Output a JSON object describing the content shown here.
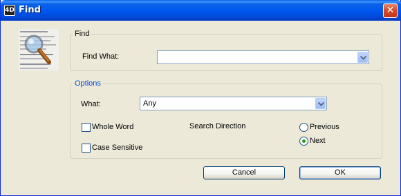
{
  "window": {
    "title": "Find",
    "app_icon_text": "4D",
    "close_glyph": "✕"
  },
  "find_group": {
    "legend": "Find",
    "find_what_label": "Find What:",
    "find_what_value": ""
  },
  "options_group": {
    "legend": "Options",
    "what_label": "What:",
    "what_value": "Any",
    "whole_word_label": "Whole Word",
    "whole_word_checked": false,
    "case_sensitive_label": "Case Sensitive",
    "case_sensitive_checked": false,
    "direction_label": "Search Direction",
    "direction_options": [
      "Previous",
      "Next"
    ],
    "direction_selected": "Next"
  },
  "buttons": {
    "cancel": "Cancel",
    "ok": "OK"
  },
  "colors": {
    "titlebar": "#0058ee",
    "legend_blue": "#0046d5",
    "radio_dot": "#21a121",
    "dialog_bg": "#ece9d8"
  },
  "icons": {
    "illustration": "magnifier-document-icon",
    "dropdown": "chevron-down-icon",
    "close": "close-icon"
  }
}
